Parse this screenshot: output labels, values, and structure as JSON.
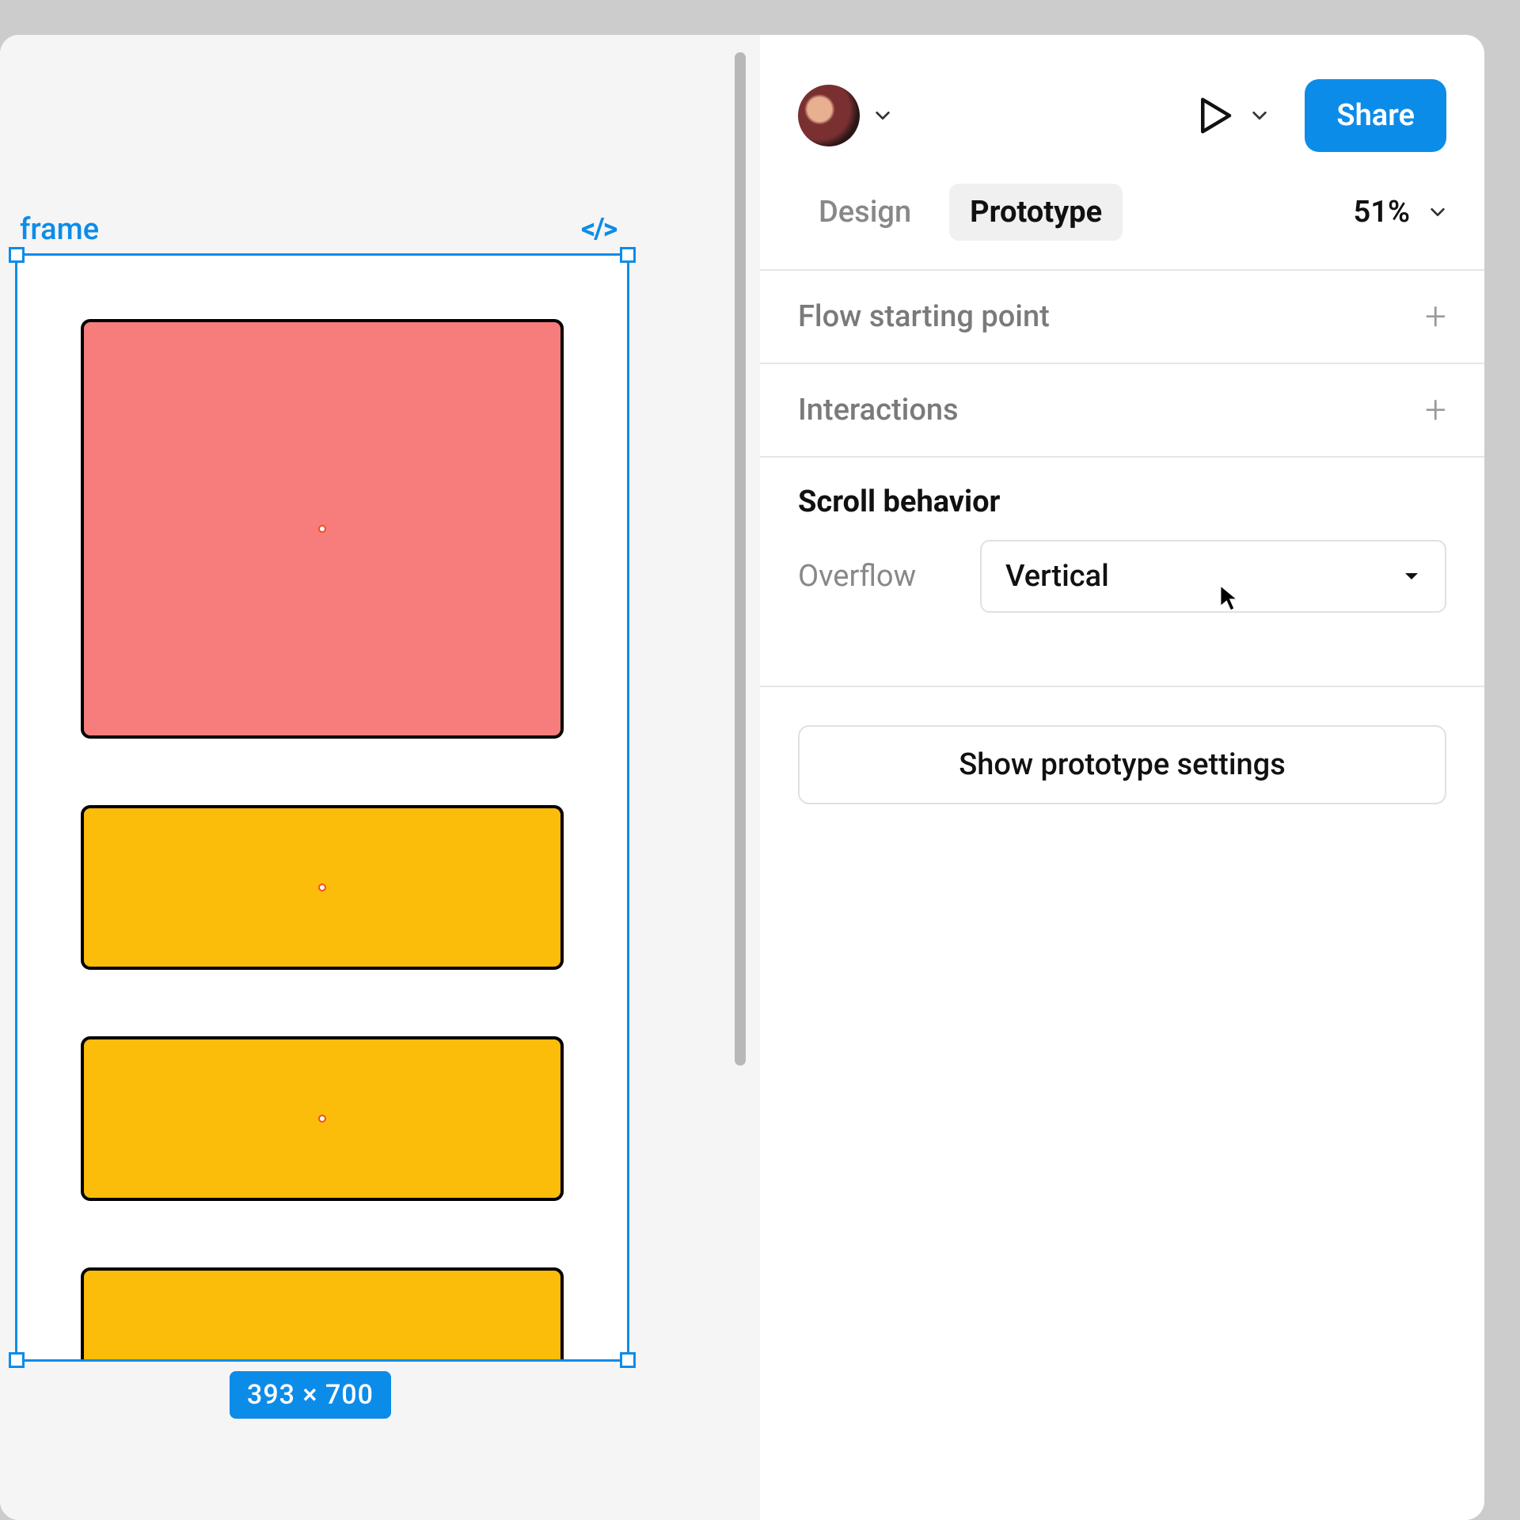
{
  "canvas": {
    "frame_label": "frame",
    "size_badge": "393 × 700"
  },
  "header": {
    "share_label": "Share"
  },
  "tabs": {
    "design": "Design",
    "prototype": "Prototype",
    "zoom": "51%"
  },
  "sections": {
    "flow": "Flow starting point",
    "interactions": "Interactions",
    "scroll_behavior": "Scroll behavior",
    "overflow_label": "Overflow",
    "overflow_value": "Vertical",
    "show_settings": "Show prototype settings"
  }
}
